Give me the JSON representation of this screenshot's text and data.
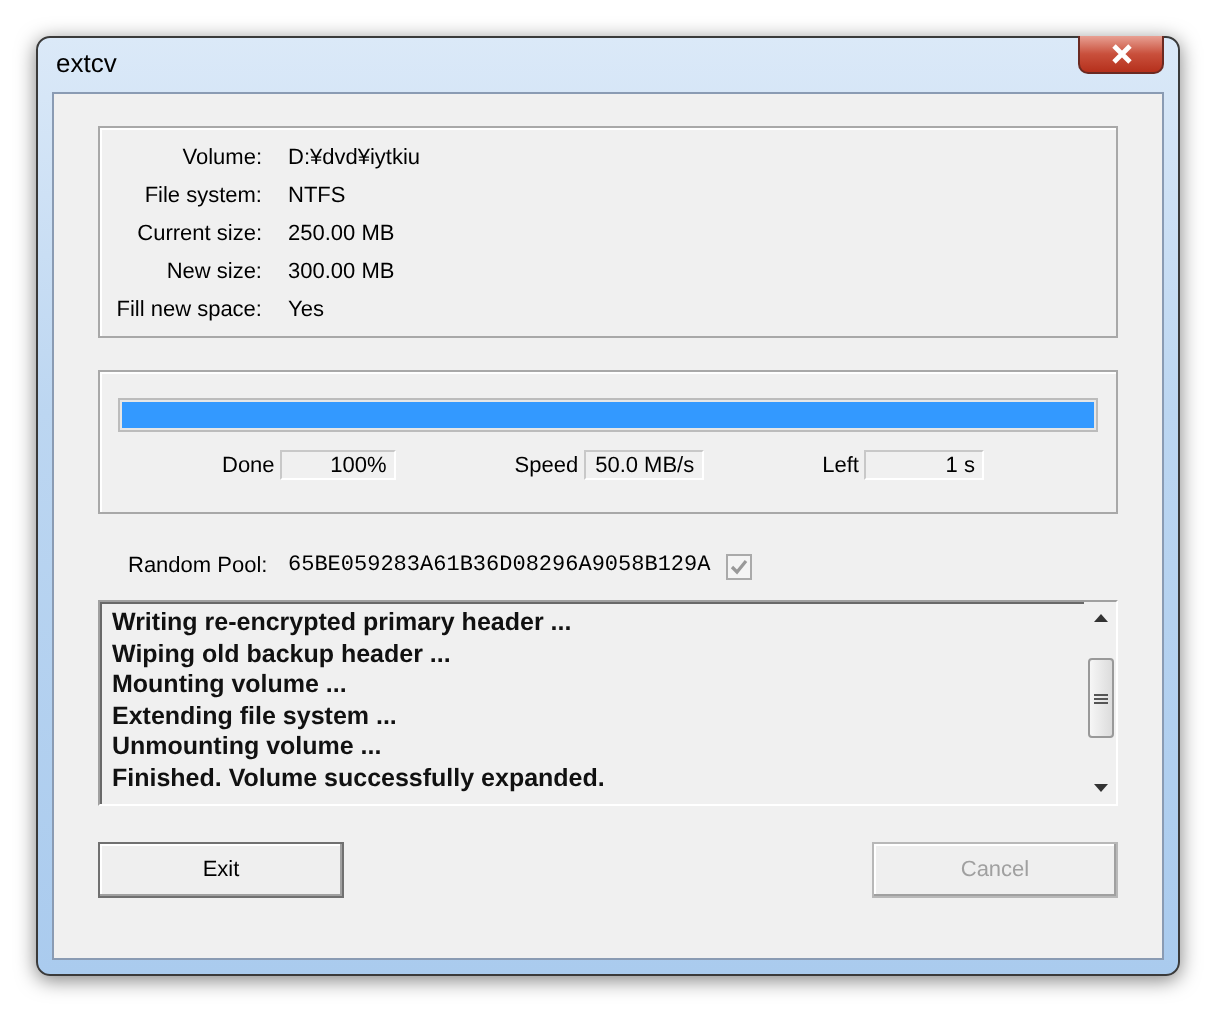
{
  "window": {
    "title": "extcv"
  },
  "info": [
    {
      "label": "Volume:",
      "value": "D:¥dvd¥iytkiu"
    },
    {
      "label": "File system:",
      "value": "NTFS"
    },
    {
      "label": "Current size:",
      "value": "250.00 MB"
    },
    {
      "label": "New size:",
      "value": "300.00 MB"
    },
    {
      "label": "Fill new space:",
      "value": "Yes"
    }
  ],
  "progress": {
    "level": 1.0
  },
  "stats": [
    {
      "label": "Done",
      "value": "100%"
    },
    {
      "label": "Speed",
      "value": "50.0 MB/s"
    },
    {
      "label": "Left",
      "value": "1 s"
    }
  ],
  "random_pool": {
    "label": "Random Pool:",
    "value": "65BE059283A61B36D08296A9058B129A",
    "checked": true,
    "disabled": true
  },
  "log": [
    "Writing re-encrypted primary header ...",
    "Wiping old backup header ...",
    "Mounting volume ...",
    "Extending file system ...",
    "Unmounting volume ...",
    "Finished. Volume successfully expanded."
  ],
  "buttons": [
    {
      "label": "Exit",
      "disabled": false
    },
    {
      "label": "Cancel",
      "disabled": true
    }
  ]
}
